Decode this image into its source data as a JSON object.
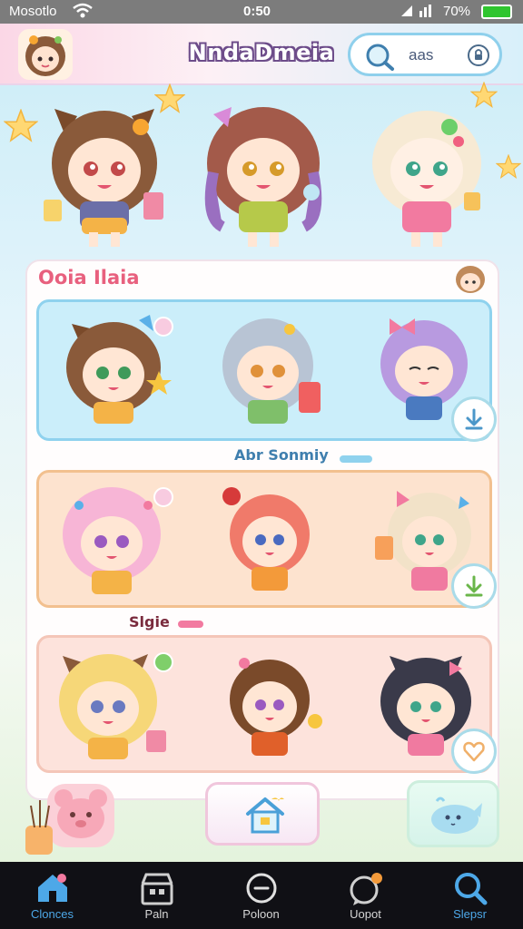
{
  "status_bar": {
    "carrier": "Mosotlo",
    "time": "0:50",
    "battery_percent": "70%"
  },
  "header": {
    "title": "NndaDmeia",
    "search_text": "aas"
  },
  "main": {
    "section_title": "Ooia Ilaia",
    "cards": [
      {
        "theme": "blue",
        "label": "Abr Sonmiy"
      },
      {
        "theme": "peach",
        "label": "Slgie"
      },
      {
        "theme": "pink",
        "label": ""
      }
    ]
  },
  "tab_bar": {
    "tabs": [
      {
        "label": "Clonces",
        "icon": "home-icon",
        "active": true
      },
      {
        "label": "Paln",
        "icon": "shop-icon",
        "active": false
      },
      {
        "label": "Poloon",
        "icon": "circle-icon",
        "active": false
      },
      {
        "label": "Uopot",
        "icon": "chat-icon",
        "active": false
      },
      {
        "label": "Slepsr",
        "icon": "search-icon",
        "active": true
      }
    ]
  },
  "colors": {
    "accent_blue": "#4da8e8",
    "accent_pink": "#e8607e",
    "card_blue": "#cbeefa",
    "card_peach": "#fde3cf",
    "card_pink": "#fde3dc",
    "tab_bar_bg": "#101015"
  }
}
